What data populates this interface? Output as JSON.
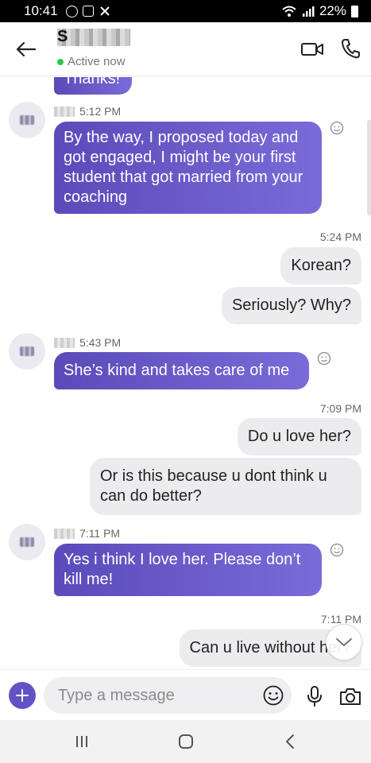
{
  "status_bar": {
    "time": "10:41",
    "battery": "22%"
  },
  "header": {
    "contact_initial": "S",
    "status": "Active now",
    "status_color": "#2fc64b"
  },
  "colors": {
    "incoming_start": "#5b4ab9",
    "incoming_end": "#7b6bd8",
    "outgoing": "#ececee",
    "accent": "#6352c6"
  },
  "messages": [
    {
      "direction": "incoming",
      "text": "Thanks!"
    },
    {
      "direction": "incoming",
      "time": "5:12 PM",
      "text": "By the way, I proposed today and got engaged, I might be your first student that got married from your coaching"
    },
    {
      "direction": "timestamp",
      "time": "5:24 PM"
    },
    {
      "direction": "outgoing",
      "text": "Korean?"
    },
    {
      "direction": "outgoing",
      "text": "Seriously? Why?"
    },
    {
      "direction": "incoming",
      "time": "5:43 PM",
      "text": "She’s kind and takes care of me"
    },
    {
      "direction": "timestamp",
      "time": "7:09 PM"
    },
    {
      "direction": "outgoing",
      "text": "Do u love her?"
    },
    {
      "direction": "outgoing",
      "text": "Or is this because u dont think u can do better?"
    },
    {
      "direction": "incoming",
      "time": "7:11 PM",
      "text": "Yes i think I love her. Please don’t kill me!"
    },
    {
      "direction": "timestamp",
      "time": "7:11 PM"
    },
    {
      "direction": "outgoing",
      "text": "Can u live without her?"
    }
  ],
  "composer": {
    "placeholder": "Type a message"
  },
  "icons": [
    "back-arrow-icon",
    "video-camera-icon",
    "phone-icon",
    "emoji-icon",
    "plus-icon",
    "microphone-icon",
    "camera-icon",
    "chevron-down-icon",
    "recent-apps-icon",
    "home-icon",
    "back-icon"
  ]
}
